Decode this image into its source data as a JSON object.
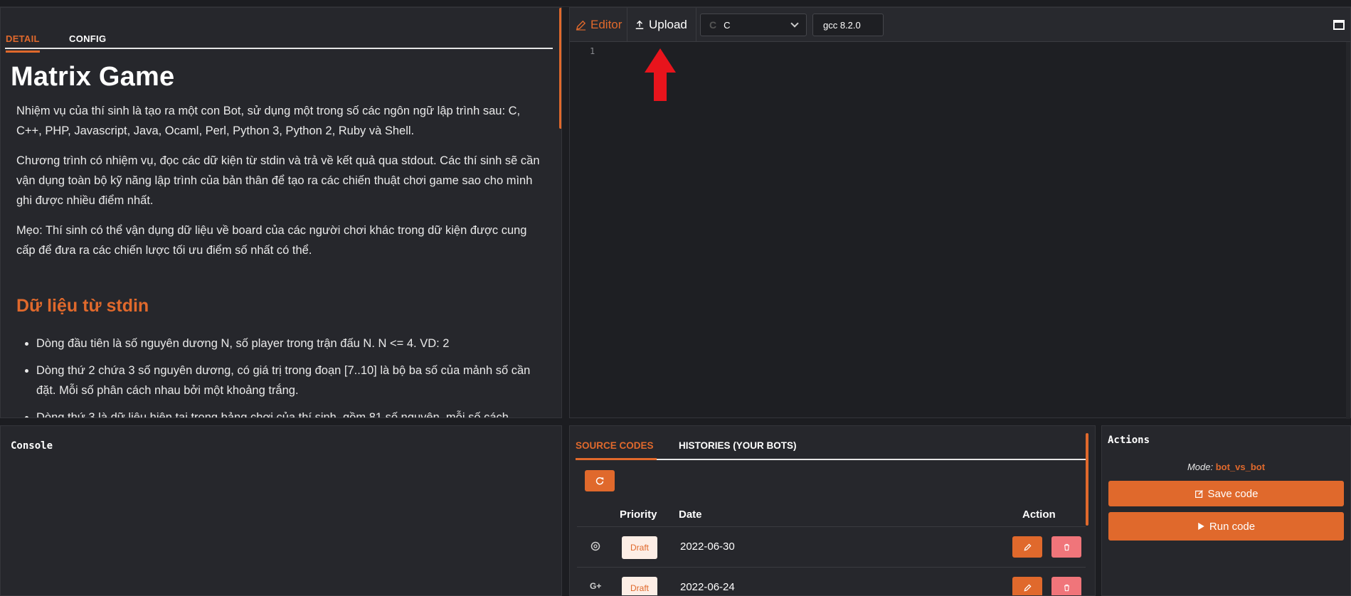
{
  "problem_tabs": {
    "detail": "DETAIL",
    "config": "CONFIG"
  },
  "problem": {
    "title": "Matrix Game",
    "paragraphs": [
      "Nhiệm vụ của thí sinh là tạo ra một con Bot, sử dụng một trong số các ngôn ngữ lập trình sau: C, C++, PHP, Javascript, Java, Ocaml, Perl, Python 3, Python 2, Ruby và Shell.",
      "Chương trình có nhiệm vụ, đọc các dữ kiện từ stdin và trả về kết quả qua stdout. Các thí sinh sẽ cần vận dụng toàn bộ kỹ năng lập trình của bản thân để tạo ra các chiến thuật chơi game sao cho mình ghi được nhiều điểm nhất.",
      "Mẹo: Thí sinh có thể vận dụng dữ liệu về board của các người chơi khác trong dữ kiện được cung cấp để đưa ra các chiến lược tối ưu điểm số nhất có thể."
    ],
    "section_heading": "Dữ liệu từ stdin",
    "bullets": [
      "Dòng đầu tiên là số nguyên dương N, số player trong trận đấu N. N <= 4. VD: 2",
      "Dòng thứ 2 chứa 3 số nguyên dương, có giá trị trong đoạn [7..10] là bộ ba số của mảnh số cần đặt. Mỗi số phân cách nhau bởi một khoảng trắng.",
      "Dòng thứ 3 là dữ liệu hiện tại trong bảng chơi của thí sinh, gồm 81 số nguyên, mỗi số cách"
    ]
  },
  "editor": {
    "tab_editor": "Editor",
    "tab_upload": "Upload",
    "language": "C",
    "compiler": "gcc 8.2.0",
    "line_numbers": [
      "1"
    ]
  },
  "console": {
    "title": "Console"
  },
  "codes": {
    "tab_source": "SOURCE CODES",
    "tab_histories": "HISTORIES (YOUR BOTS)",
    "columns": {
      "priority": "Priority",
      "date": "Date",
      "action": "Action"
    },
    "rows": [
      {
        "icon": "openai-icon",
        "status": "Draft",
        "date": "2022-06-30"
      },
      {
        "icon": "google-plus-icon",
        "status": "Draft",
        "date": "2022-06-24"
      }
    ]
  },
  "actions": {
    "title": "Actions",
    "mode_label": "Mode:",
    "mode_value": "bot_vs_bot",
    "save_label": "Save code",
    "run_label": "Run code"
  },
  "colors": {
    "accent": "#e0692c",
    "danger": "#f0757a",
    "panel": "#26272c",
    "background": "#1c1d21"
  }
}
